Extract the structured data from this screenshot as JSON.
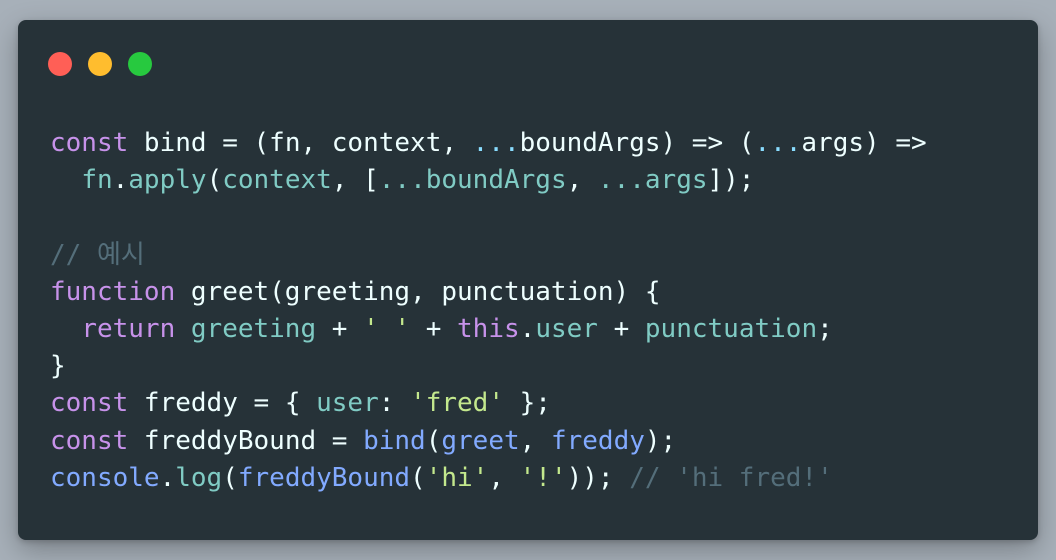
{
  "window": {
    "controls": [
      {
        "name": "close",
        "color": "#ff5f56"
      },
      {
        "name": "minimize",
        "color": "#ffbd2e"
      },
      {
        "name": "zoom",
        "color": "#27c93f"
      }
    ]
  },
  "colors": {
    "page_background": "#a7b0b9",
    "editor_background": "#263238",
    "keyword": "#c792ea",
    "function": "#82aaff",
    "property": "#80cbc4",
    "string": "#c3e88d",
    "comment": "#546e7a",
    "text": "#eeffff"
  },
  "code": {
    "lines": [
      [
        {
          "text": "const",
          "type": "kw"
        },
        {
          "text": " bind = (fn, context, ",
          "type": "punc"
        },
        {
          "text": "...",
          "type": "op"
        },
        {
          "text": "boundArgs) => (",
          "type": "punc"
        },
        {
          "text": "...",
          "type": "op"
        },
        {
          "text": "args) =>",
          "type": "punc"
        }
      ],
      [
        {
          "text": "  ",
          "type": "punc"
        },
        {
          "text": "fn",
          "type": "prop"
        },
        {
          "text": ".",
          "type": "punc"
        },
        {
          "text": "apply",
          "type": "prop"
        },
        {
          "text": "(",
          "type": "punc"
        },
        {
          "text": "context",
          "type": "prop"
        },
        {
          "text": ", [",
          "type": "punc"
        },
        {
          "text": "...boundArgs",
          "type": "prop"
        },
        {
          "text": ", ",
          "type": "punc"
        },
        {
          "text": "...args",
          "type": "prop"
        },
        {
          "text": "]);",
          "type": "punc"
        }
      ],
      [],
      [
        {
          "text": "// 예시",
          "type": "cmt"
        }
      ],
      [
        {
          "text": "function",
          "type": "kw"
        },
        {
          "text": " greet(greeting, punctuation) {",
          "type": "punc"
        }
      ],
      [
        {
          "text": "  ",
          "type": "punc"
        },
        {
          "text": "return",
          "type": "kw"
        },
        {
          "text": " ",
          "type": "punc"
        },
        {
          "text": "greeting",
          "type": "prop"
        },
        {
          "text": " + ",
          "type": "punc"
        },
        {
          "text": "' '",
          "type": "str"
        },
        {
          "text": " + ",
          "type": "punc"
        },
        {
          "text": "this",
          "type": "kw"
        },
        {
          "text": ".",
          "type": "punc"
        },
        {
          "text": "user",
          "type": "prop"
        },
        {
          "text": " + ",
          "type": "punc"
        },
        {
          "text": "punctuation",
          "type": "prop"
        },
        {
          "text": ";",
          "type": "punc"
        }
      ],
      [
        {
          "text": "}",
          "type": "punc"
        }
      ],
      [
        {
          "text": "const",
          "type": "kw"
        },
        {
          "text": " freddy = { ",
          "type": "punc"
        },
        {
          "text": "user",
          "type": "prop"
        },
        {
          "text": ": ",
          "type": "punc"
        },
        {
          "text": "'fred'",
          "type": "str"
        },
        {
          "text": " };",
          "type": "punc"
        }
      ],
      [
        {
          "text": "const",
          "type": "kw"
        },
        {
          "text": " freddyBound = ",
          "type": "punc"
        },
        {
          "text": "bind",
          "type": "fn"
        },
        {
          "text": "(",
          "type": "punc"
        },
        {
          "text": "greet",
          "type": "fn"
        },
        {
          "text": ", ",
          "type": "punc"
        },
        {
          "text": "freddy",
          "type": "fn"
        },
        {
          "text": ");",
          "type": "punc"
        }
      ],
      [
        {
          "text": "console",
          "type": "fn"
        },
        {
          "text": ".",
          "type": "punc"
        },
        {
          "text": "log",
          "type": "prop"
        },
        {
          "text": "(",
          "type": "punc"
        },
        {
          "text": "freddyBound",
          "type": "fn"
        },
        {
          "text": "(",
          "type": "punc"
        },
        {
          "text": "'hi'",
          "type": "str"
        },
        {
          "text": ", ",
          "type": "punc"
        },
        {
          "text": "'!'",
          "type": "str"
        },
        {
          "text": ")); ",
          "type": "punc"
        },
        {
          "text": "// 'hi fred!'",
          "type": "cmt"
        }
      ]
    ]
  }
}
